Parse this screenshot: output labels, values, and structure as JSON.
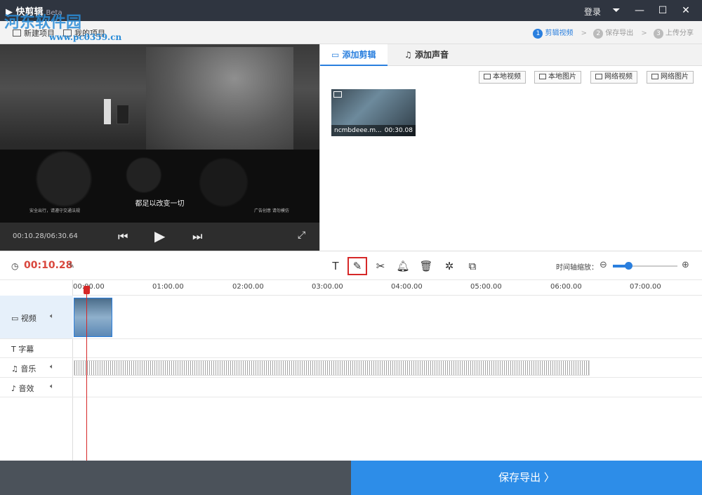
{
  "app": {
    "title": "快剪辑",
    "badge": "Beta",
    "login": "登录"
  },
  "window_controls": {
    "menu": "⏷",
    "minimize": "—",
    "maximize": "☐",
    "close": "✕"
  },
  "watermark": {
    "line1": "河东软件园",
    "line2": "www.pc0359.cn"
  },
  "nav": {
    "new_project": "新建项目",
    "my_projects": "我的项目"
  },
  "steps": [
    {
      "num": "1",
      "label": "剪辑视频",
      "active": true
    },
    {
      "num": "2",
      "label": "保存导出",
      "active": false
    },
    {
      "num": "3",
      "label": "上传分享",
      "active": false
    }
  ],
  "preview": {
    "subtitle": "都足以改变一切",
    "caption_left": "安全出行，请遵守交通法规",
    "caption_right": "广告创意 请勿模仿",
    "time": "00:10.28/06:30.64",
    "prev_icon": "skip-back-icon",
    "play_icon": "play-icon",
    "next_icon": "skip-forward-icon",
    "fullscreen_icon": "fullscreen-icon"
  },
  "tabs": {
    "add_clip": "添加剪辑",
    "add_audio": "添加声音"
  },
  "sources": {
    "local_video": "本地视频",
    "local_image": "本地图片",
    "web_video": "网络视频",
    "web_image": "网络图片"
  },
  "clip": {
    "name": "ncmbdeee.m...",
    "duration": "00:30.08"
  },
  "toolbar": {
    "current_time": "00:10.28",
    "zoom_label": "时间轴缩放：",
    "zoom_level": 0.2,
    "tools": [
      "text-icon",
      "pencil-icon",
      "scissors-icon",
      "bell-icon",
      "trash-icon",
      "effects-icon",
      "copy-icon"
    ]
  },
  "ruler": [
    "00:00.00",
    "01:00.00",
    "02:00.00",
    "03:00.00",
    "04:00.00",
    "05:00.00",
    "06:00.00",
    "07:00.00"
  ],
  "tracks": {
    "video": "视频",
    "subtitle": "字幕",
    "music": "音乐",
    "sfx": "音效"
  },
  "footer": {
    "export": "保存导出 〉"
  },
  "colors": {
    "accent": "#2a7fde",
    "playhead": "#d62828",
    "titlebar": "#2f3540",
    "export": "#2d8de8"
  }
}
